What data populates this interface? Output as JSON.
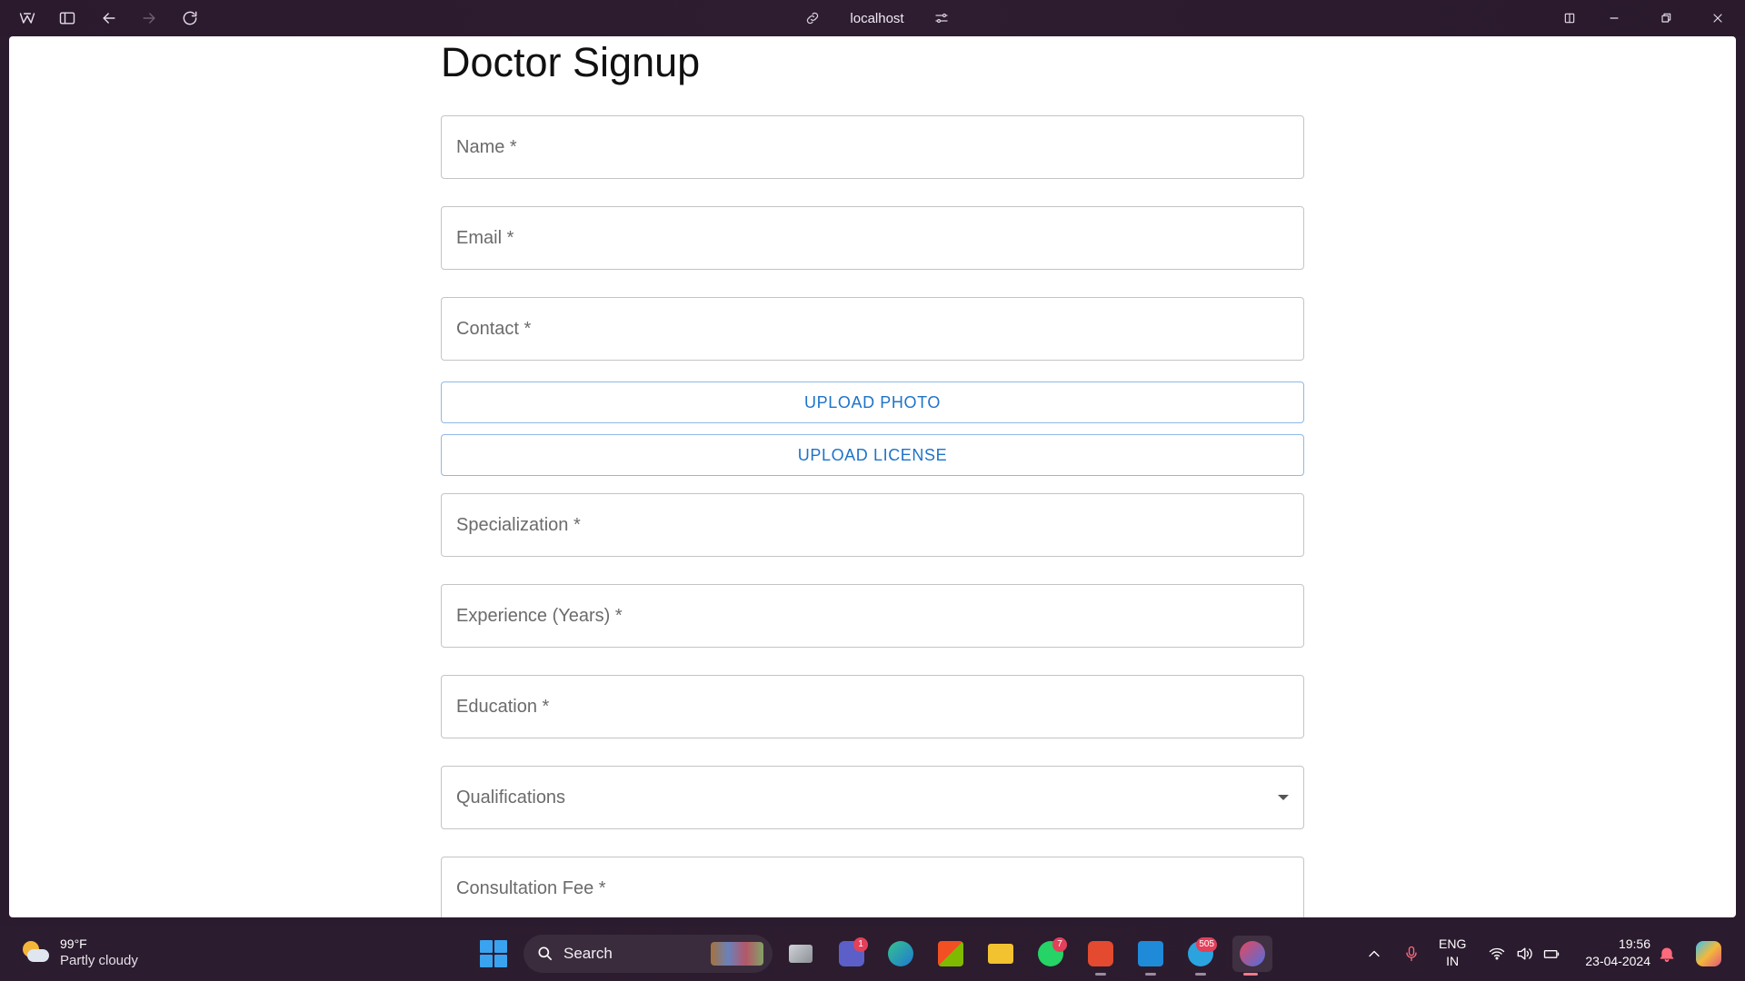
{
  "browser": {
    "url": "localhost"
  },
  "page": {
    "title": "Doctor Signup",
    "fields": {
      "name": "Name *",
      "email": "Email *",
      "contact": "Contact *",
      "specialization": "Specialization *",
      "experience": "Experience (Years) *",
      "education": "Education *",
      "qualifications": "Qualifications",
      "consultation_fee": "Consultation Fee *"
    },
    "buttons": {
      "upload_photo": "UPLOAD PHOTO",
      "upload_license": "UPLOAD LICENSE"
    },
    "accent_color": "#1e73c8"
  },
  "taskbar": {
    "weather": {
      "temp": "99°F",
      "desc": "Partly cloudy"
    },
    "search_label": "Search",
    "badges": {
      "teams": "1",
      "whatsapp": "7",
      "telegram": "505"
    },
    "language": {
      "line1": "ENG",
      "line2": "IN"
    },
    "clock": {
      "time": "19:56",
      "date": "23-04-2024"
    }
  }
}
